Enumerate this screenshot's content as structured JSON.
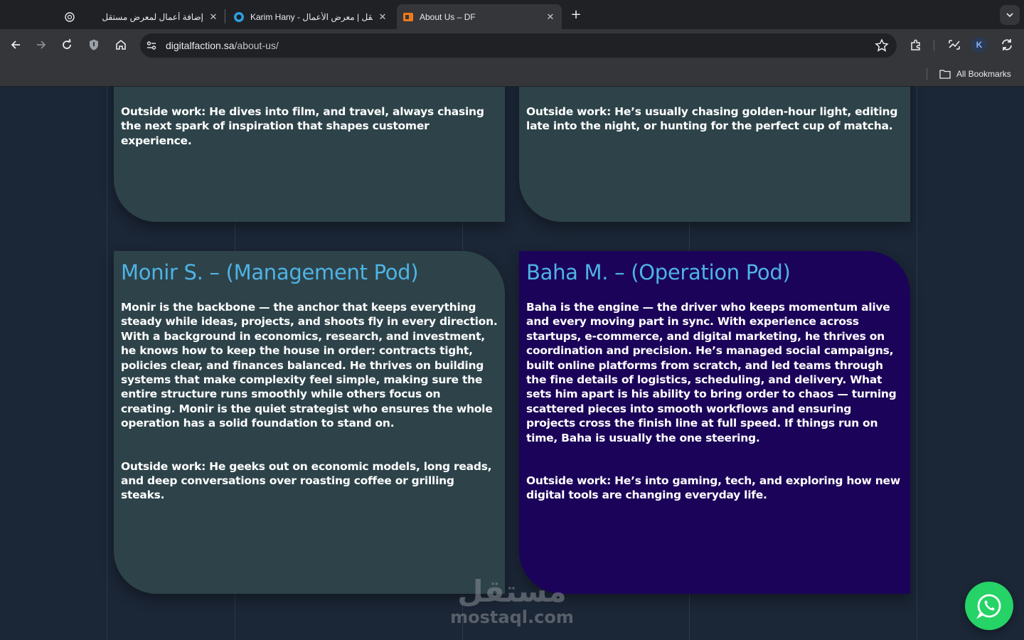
{
  "browser": {
    "tabs": [
      {
        "title": "إضافة أعمال لمعرض مستقل",
        "icon": "openai-icon",
        "active": false
      },
      {
        "title": "Karim Hany - مستقل | معرض الأعمال",
        "icon": "mostaql-icon",
        "active": false
      },
      {
        "title": "About Us – DF",
        "icon": "df-icon",
        "active": true
      }
    ],
    "new_tab_label": "+",
    "close_label": "✕",
    "url_domain": "digitalfaction.sa",
    "url_path": "/about-us/",
    "profile_initial": "K",
    "bookmarks_label": "All Bookmarks"
  },
  "team": {
    "top_left": {
      "outside": "Outside work: He dives into film, and travel, always chasing the next spark of inspiration that shapes customer experience."
    },
    "top_right": {
      "outside": "Outside work: He’s usually chasing golden-hour light, editing late into the night, or hunting for the perfect cup of matcha."
    },
    "monir": {
      "name": "Monir S. – (Management Pod)",
      "bio": "Monir is the backbone — the anchor that keeps everything steady while ideas, projects, and shoots fly in every direction. With a background in economics, research, and investment, he knows how to keep the house in order: contracts tight, policies clear, and finances balanced. He thrives on building systems that make complexity feel simple, making sure the entire structure runs smoothly while others focus on creating. Monir is the quiet strategist who ensures the whole operation has a solid foundation to stand on.",
      "outside": "Outside work: He geeks out on economic models, long reads, and deep conversations over roasting coffee or grilling steaks."
    },
    "baha": {
      "name": "Baha M. – (Operation Pod)",
      "bio": "Baha is the engine — the driver who keeps momentum alive and every moving part in sync. With experience across startups, e-commerce, and digital marketing, he thrives on coordination and precision. He’s managed social campaigns, built online platforms from scratch, and led teams through the fine details of logistics, scheduling, and delivery. What sets him apart is his ability to bring order to chaos — turning scattered pieces into smooth workflows and ensuring projects cross the finish line at full speed. If things run on time, Baha is usually the one steering.",
      "outside": "Outside work: He’s into gaming, tech, and exploring how new digital tools are changing everyday life."
    }
  },
  "watermark": {
    "arabic": "مستقل",
    "latin": "mostaql.com"
  },
  "colors": {
    "page_bg": "#1b2636",
    "card_teal": "#2d4349",
    "card_purple": "#1b0359",
    "name_blue": "#4fb3e6",
    "whatsapp_green": "#25d366"
  }
}
